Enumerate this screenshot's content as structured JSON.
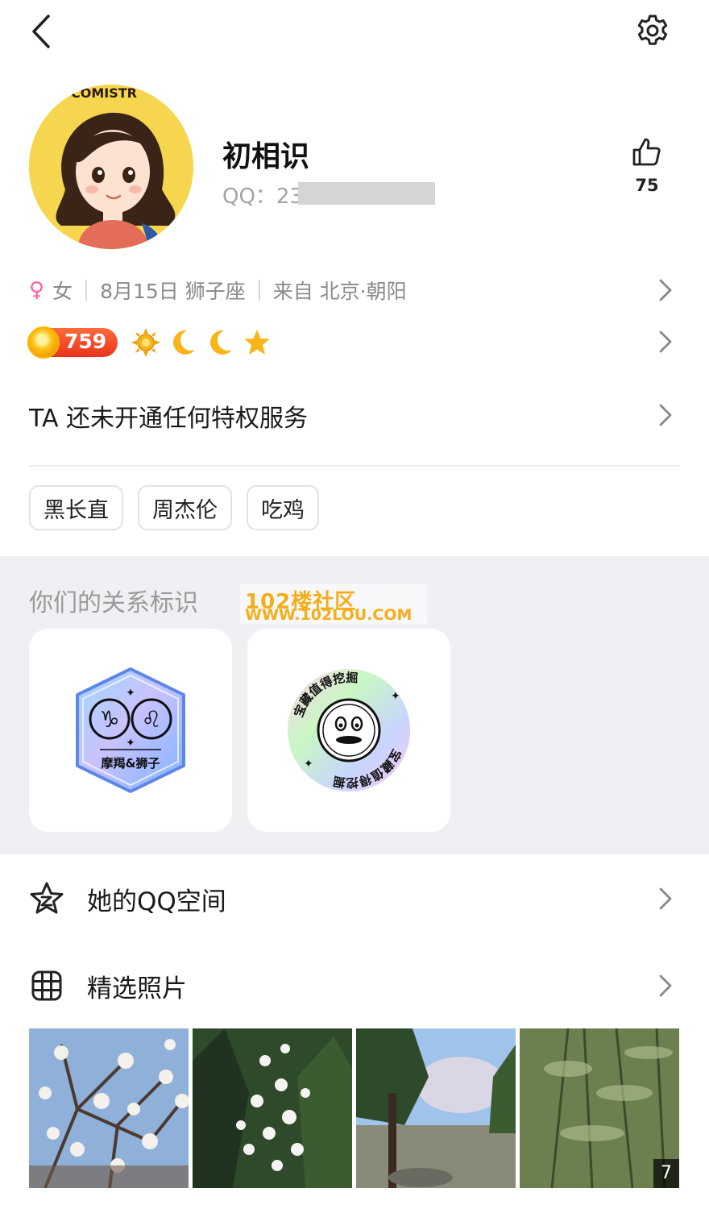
{
  "topbar": {
    "back_icon": "back-arrow-icon",
    "settings_icon": "gear-icon"
  },
  "profile": {
    "avatar_text": "COMISTR",
    "nickname": "初相识",
    "qq_label": "QQ：23",
    "likes": "75"
  },
  "info": {
    "gender_symbol": "♀",
    "gender": "女",
    "birthday": "8月15日 狮子座",
    "location": "来自 北京·朝阳"
  },
  "level": {
    "coins": "759",
    "icons": [
      "sun-icon",
      "moon-icon",
      "moon-icon",
      "star-icon"
    ]
  },
  "privilege": {
    "text": "TA 还未开通任何特权服务"
  },
  "tags": [
    "黑长直",
    "周杰伦",
    "吃鸡"
  ],
  "relation": {
    "title": "你们的关系标识",
    "watermark_line1": "102楼社区",
    "watermark_line2": "WWW.102LOU.COM",
    "badge1_label": "摩羯&狮子",
    "badge2_text_top": "宝藏值得挖掘",
    "badge2_text_bottom": "宝藏值得挖掘"
  },
  "menu": {
    "qzone": "她的QQ空间",
    "photos": "精选照片"
  },
  "photos": {
    "count": "7"
  },
  "colors": {
    "accent": "#ff5ea6",
    "coin_badge": "#e8341c",
    "section_bg": "#eff0f4"
  }
}
